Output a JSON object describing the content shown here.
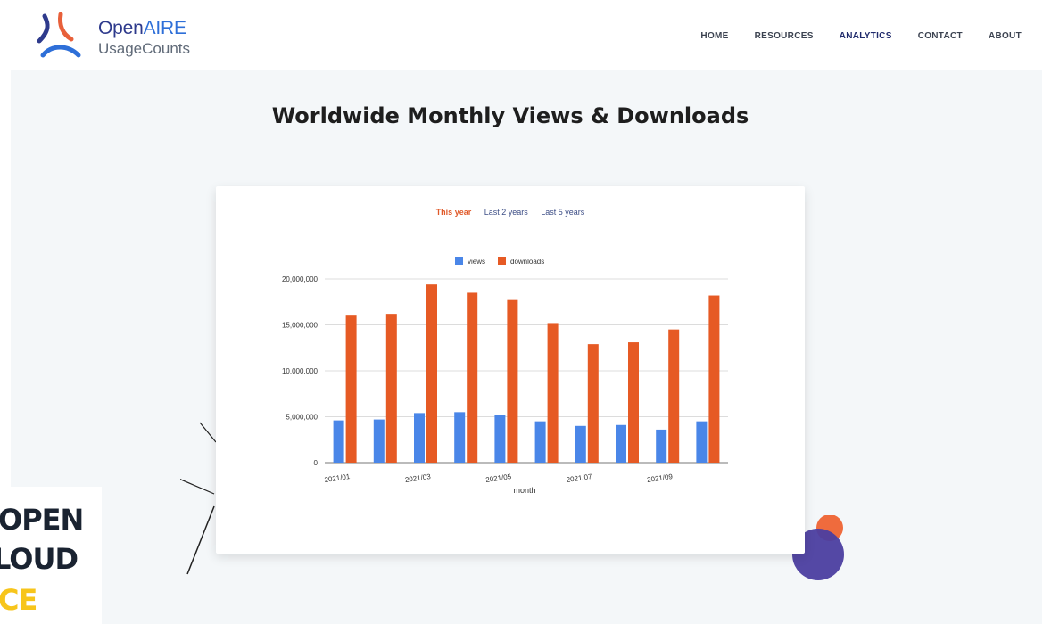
{
  "brand": {
    "name_part1": "Open",
    "name_part2": "AIRE",
    "subtitle": "UsageCounts"
  },
  "nav": {
    "items": [
      {
        "label": "HOME",
        "active": false
      },
      {
        "label": "RESOURCES",
        "active": false
      },
      {
        "label": "ANALYTICS",
        "active": true
      },
      {
        "label": "CONTACT",
        "active": false
      },
      {
        "label": "ABOUT",
        "active": false
      }
    ]
  },
  "page": {
    "title": "Worldwide Monthly Views & Downloads"
  },
  "range_tabs": [
    {
      "label": "This year",
      "active": true
    },
    {
      "label": "Last 2 years",
      "active": false
    },
    {
      "label": "Last 5 years",
      "active": false
    }
  ],
  "badge": {
    "line1": "OPEN",
    "line2": "LOUD",
    "line3": "CE"
  },
  "colors": {
    "views": "#4a86e8",
    "downloads": "#e65a24",
    "brand_navy": "#2e3a8c",
    "accent_orange": "#ef6b3d",
    "accent_purple": "#4b3ea0"
  },
  "chart_data": {
    "type": "bar",
    "title": "",
    "xlabel": "month",
    "ylabel": "",
    "ylim": [
      0,
      20000000
    ],
    "y_ticks": [
      "0",
      "5,000,000",
      "10,000,000",
      "15,000,000",
      "20,000,000"
    ],
    "y_tick_values": [
      0,
      5000000,
      10000000,
      15000000,
      20000000
    ],
    "categories": [
      "2021/01",
      "2021/02",
      "2021/03",
      "2021/04",
      "2021/05",
      "2021/06",
      "2021/07",
      "2021/08",
      "2021/09",
      "2021/10"
    ],
    "x_tick_labels": [
      "2021/01",
      "2021/03",
      "2021/05",
      "2021/07",
      "2021/09"
    ],
    "legend_position": "top",
    "series": [
      {
        "name": "views",
        "values": [
          4600000,
          4700000,
          5400000,
          5500000,
          5200000,
          4500000,
          4000000,
          4100000,
          3600000,
          4500000
        ]
      },
      {
        "name": "downloads",
        "values": [
          16100000,
          16200000,
          19400000,
          18500000,
          17800000,
          15200000,
          12900000,
          13100000,
          14500000,
          18200000
        ]
      }
    ]
  }
}
